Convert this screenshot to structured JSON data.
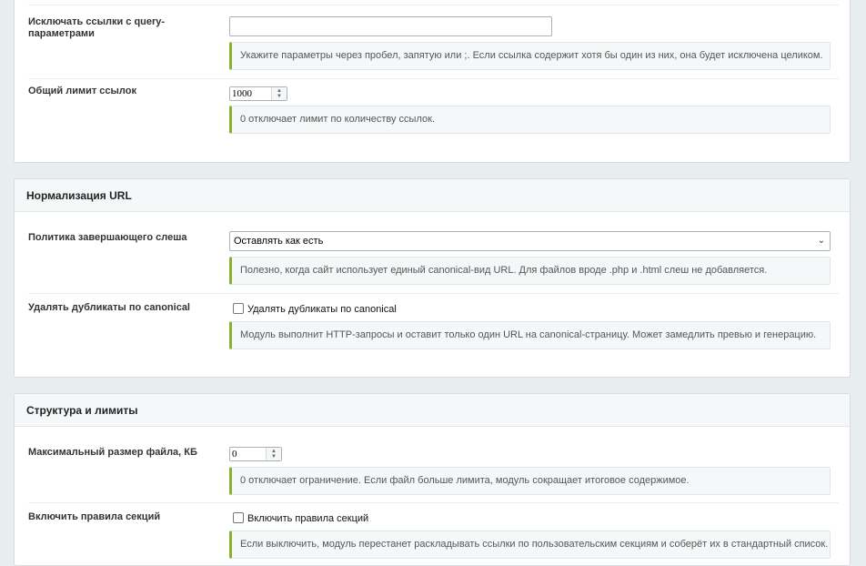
{
  "panel1": {
    "rows": [
      {
        "label": "Исключать ссылки с query-параметрами",
        "input_value": "",
        "hint": "Укажите параметры через пробел, запятую или ;. Если ссылка содержит хотя бы один из них, она будет исключена целиком."
      },
      {
        "label": "Общий лимит ссылок",
        "input_value": "1000",
        "hint": "0 отключает лимит по количеству ссылок."
      }
    ]
  },
  "panel2": {
    "title": "Нормализация URL",
    "rows": [
      {
        "label": "Политика завершающего слеша",
        "select_value": "Оставлять как есть",
        "hint": "Полезно, когда сайт использует единый canonical-вид URL. Для файлов вроде .php и .html слеш не добавляется."
      },
      {
        "label": "Удалять дубликаты по canonical",
        "checkbox_label": "Удалять дубликаты по canonical",
        "checked": false,
        "hint": "Модуль выполнит HTTP-запросы и оставит только один URL на canonical-страницу. Может замедлить превью и генерацию."
      }
    ]
  },
  "panel3": {
    "title": "Структура и лимиты",
    "rows": [
      {
        "label": "Максимальный размер файла, КБ",
        "input_value": "0",
        "hint": "0 отключает ограничение. Если файл больше лимита, модуль сокращает итоговое содержимое."
      },
      {
        "label": "Включить правила секций",
        "checkbox_label": "Включить правила секций",
        "checked": false,
        "hint": "Если выключить, модуль перестанет раскладывать ссылки по пользовательским секциям и соберёт их в стандартный список."
      }
    ]
  },
  "colors": {
    "accent": "#8ab032",
    "page_bg": "#e8eef0",
    "panel_bg": "#ffffff"
  }
}
